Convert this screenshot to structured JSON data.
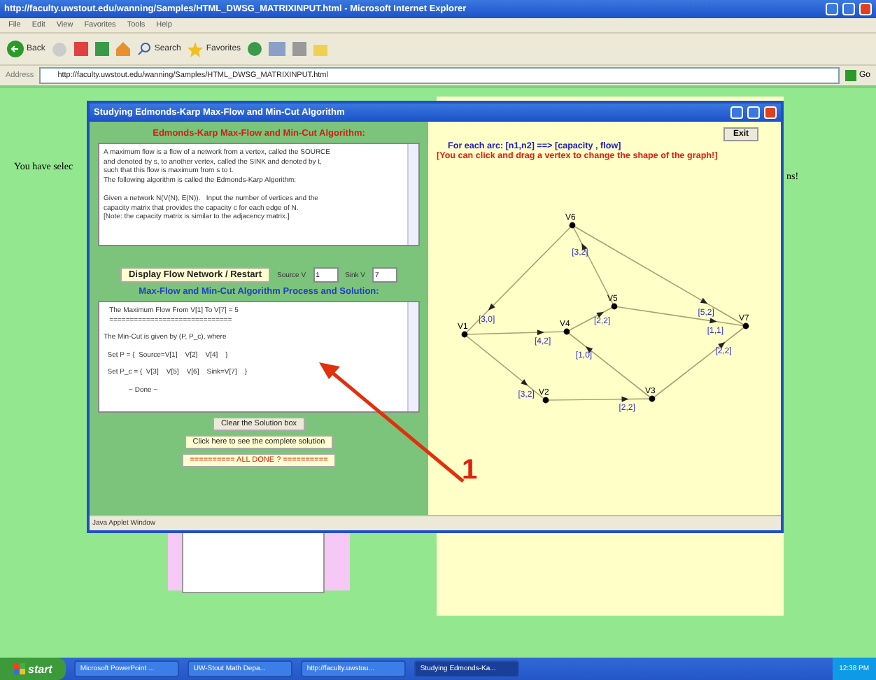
{
  "browser": {
    "title": "http://faculty.uwstout.edu/wanning/Samples/HTML_DWSG_MATRIXINPUT.html - Microsoft Internet Explorer",
    "menu": [
      "File",
      "Edit",
      "View",
      "Favorites",
      "Tools",
      "Help"
    ],
    "toolbar": [
      "Back",
      "Search",
      "Favorites"
    ],
    "address_label": "Address",
    "url": "http://faculty.uwstout.edu/wanning/Samples/HTML_DWSG_MATRIXINPUT.html",
    "go": "Go"
  },
  "page": {
    "left_text": "You have selec",
    "right_text": "ns!"
  },
  "applet": {
    "title": "Studying Edmonds-Karp Max-Flow and Min-Cut Algorithm",
    "heading": "Edmonds-Karp Max-Flow and Min-Cut Algorithm:",
    "intro": [
      "A maximum flow is a flow of a network from a vertex, called the SOURCE",
      "and denoted by s, to another vertex, called the SINK and denoted by t,",
      "such that this flow is maximum from s to t.",
      "The following algorithm is called the Edmonds-Karp Algorithm:",
      "Given a network N(V(N), E(N)).   Input the number of vertices and the",
      "capacity matrix that provides the capacity c for each edge of N.",
      "[Note: the capacity matrix is similar to the adjacency matrix.]"
    ],
    "display_button": "Display Flow Network / Restart",
    "source_label": "Source V",
    "source_value": "1",
    "sink_label": "Sink V",
    "sink_value": "7",
    "solution_heading": "Max-Flow and Min-Cut Algorithm Process and Solution:",
    "solution": [
      "   The Maximum Flow From V[1] To V[7] = 5",
      "   ==============================",
      "The Min-Cut is given by (P, P_c), where",
      "  Set P = {  Source=V[1]    V[2]    V[4]    }",
      "  Set P_c = {  V[3]    V[5]    V[6]    Sink=V[7]    }",
      "             ~ Done ~"
    ],
    "buttons": [
      "Clear the Solution box",
      "Click here to see the complete solution",
      "==========   ALL DONE ?   =========="
    ],
    "exit": "Exit",
    "legend": "For each arc: [n1,n2] ==> [capacity , flow]",
    "hint": "[You can click and drag a vertex to change the shape of the graph!]",
    "vertices": [
      "V1",
      "V2",
      "V3",
      "V4",
      "V5",
      "V6",
      "V7"
    ],
    "arcs": [
      "[3,0]",
      "[3,2]",
      "[5,2]",
      "[4,2]",
      "[2,2]",
      "[1,1]",
      "[1,0]",
      "[3,2]",
      "[2,2]",
      "[2,2]"
    ],
    "status": "Java Applet Window"
  },
  "annotation": {
    "label": "1"
  },
  "taskbar": {
    "start": "start",
    "tasks": [
      {
        "label": "Microsoft PowerPoint ...",
        "selected": false
      },
      {
        "label": "UW-Stout Math Depa...",
        "selected": false
      },
      {
        "label": "http://faculty.uwstou...",
        "selected": false
      },
      {
        "label": "Studying Edmonds-Ka...",
        "selected": true
      }
    ],
    "clock": "12:38 PM"
  }
}
